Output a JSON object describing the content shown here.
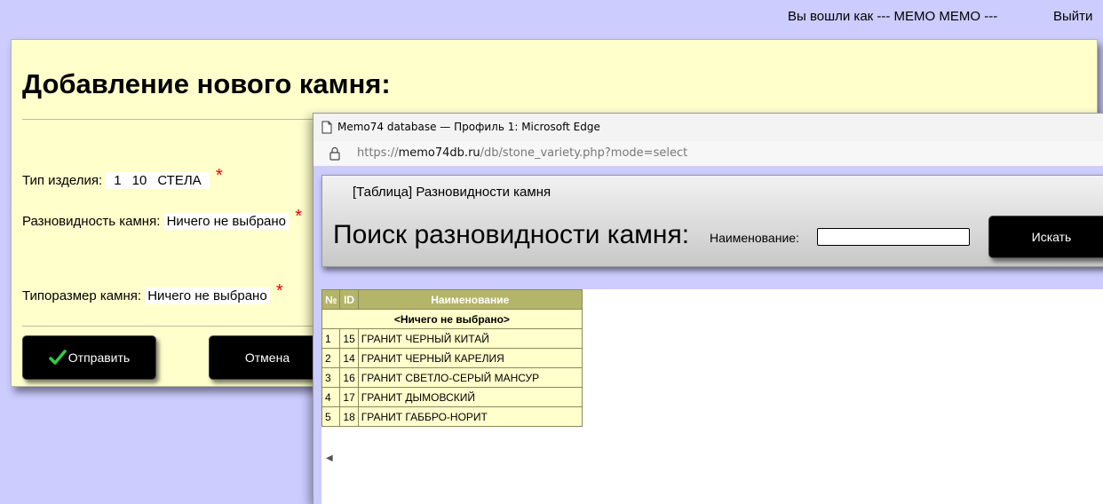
{
  "header": {
    "user_label": "Вы вошли как  --- MEMO MEMO ---",
    "logout": "Выйти"
  },
  "form": {
    "title": "Добавление нового камня:",
    "type_label": "Тип изделия:",
    "type_values": [
      "1",
      "10",
      "СТЕЛА"
    ],
    "variety_label": "Разновидность камня:",
    "variety_value": "Ничего не выбрано",
    "size_label": "Типоразмер камня:",
    "size_value": "Ничего не выбрано",
    "required_mark": "*",
    "submit_label": "Отправить",
    "cancel_label": "Отмена"
  },
  "popup": {
    "window_title": "Memo74 database — Профиль 1: Microsoft Edge",
    "url_prefix": "https://",
    "url_host": "memo74db.ru",
    "url_path": "/db/stone_variety.php?mode=select",
    "breadcrumb": "[Таблица] Разновидности камня",
    "search_title": "Поиск разновидности камня:",
    "name_label": "Наименование:",
    "search_value": "",
    "search_button": "Искать",
    "table": {
      "headers": [
        "№",
        "ID",
        "Наименование"
      ],
      "none_row": "<Ничего не выбрано>",
      "rows": [
        [
          "1",
          "15",
          "ГРАНИТ ЧЕРНЫЙ КИТАЙ"
        ],
        [
          "2",
          "14",
          "ГРАНИТ ЧЕРНЫЙ КАРЕЛИЯ"
        ],
        [
          "3",
          "16",
          "ГРАНИТ СВЕТЛО-СЕРЫЙ МАНСУР"
        ],
        [
          "4",
          "17",
          "ГРАНИТ ДЫМОВСКИЙ"
        ],
        [
          "5",
          "18",
          "ГРАНИТ ГАББРО-НОРИТ"
        ]
      ]
    }
  },
  "colors": {
    "page_bg": "#ccccff",
    "form_bg": "#ffffcc",
    "table_header": "#b5b56a",
    "required": "#ee0000"
  }
}
